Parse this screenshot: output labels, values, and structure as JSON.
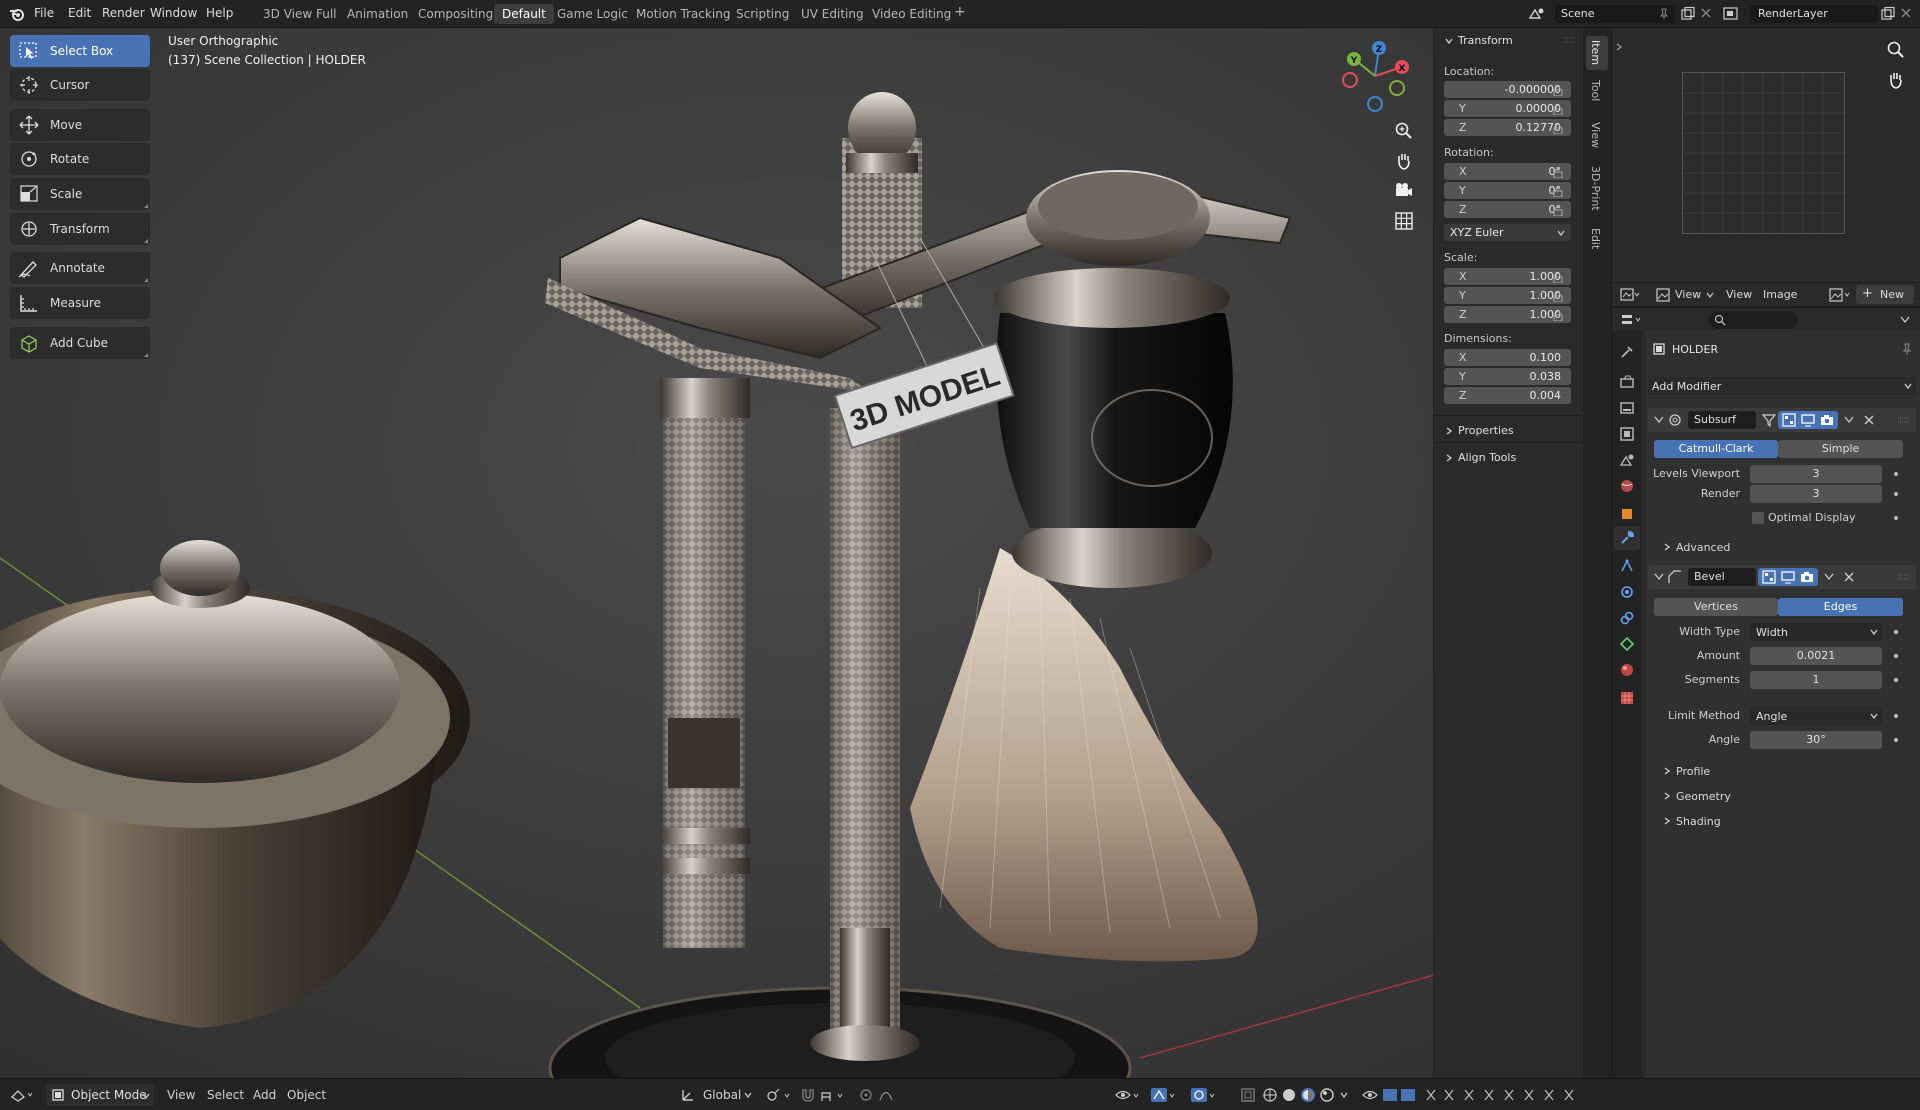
{
  "topbar": {
    "menus": [
      "File",
      "Edit",
      "Render",
      "Window",
      "Help"
    ],
    "workspaces": [
      "3D View Full",
      "Animation",
      "Compositing",
      "Default",
      "Game Logic",
      "Motion Tracking",
      "Scripting",
      "UV Editing",
      "Video Editing"
    ],
    "active_workspace": "Default",
    "add_label": "+",
    "scene": "Scene",
    "render_layer": "RenderLayer"
  },
  "viewport": {
    "view_name": "User Orthographic",
    "collection": "(137) Scene Collection | HOLDER",
    "tag_text": "3D MODEL"
  },
  "tools": [
    {
      "label": "Select Box",
      "icon": "select-box-icon",
      "active": true
    },
    {
      "label": "Cursor",
      "icon": "cursor-icon"
    },
    {
      "label": "Move",
      "icon": "move-icon"
    },
    {
      "label": "Rotate",
      "icon": "rotate-icon"
    },
    {
      "label": "Scale",
      "icon": "scale-icon"
    },
    {
      "label": "Transform",
      "icon": "transform-icon"
    },
    {
      "label": "Annotate",
      "icon": "annotate-icon"
    },
    {
      "label": "Measure",
      "icon": "measure-icon"
    },
    {
      "label": "Add Cube",
      "icon": "add-cube-icon"
    }
  ],
  "gizmo": {
    "x": "X",
    "y": "Y",
    "z": "Z"
  },
  "npanel": {
    "header": "Transform",
    "location_label": "Location:",
    "location": [
      {
        "axis": "X",
        "value": "-0.000000"
      },
      {
        "axis": "Y",
        "value": "0.00000"
      },
      {
        "axis": "Z",
        "value": "0.12770"
      }
    ],
    "rotation_label": "Rotation:",
    "rotation": [
      {
        "axis": "X",
        "value": "0°"
      },
      {
        "axis": "Y",
        "value": "0°"
      },
      {
        "axis": "Z",
        "value": "0°"
      }
    ],
    "rotation_mode": "XYZ Euler",
    "scale_label": "Scale:",
    "scale": [
      {
        "axis": "X",
        "value": "1.000"
      },
      {
        "axis": "Y",
        "value": "1.000"
      },
      {
        "axis": "Z",
        "value": "1.000"
      }
    ],
    "dimensions_label": "Dimensions:",
    "dimensions": [
      {
        "axis": "X",
        "value": "0.100"
      },
      {
        "axis": "Y",
        "value": "0.038"
      },
      {
        "axis": "Z",
        "value": "0.004"
      }
    ],
    "properties_label": "Properties",
    "align_tools_label": "Align Tools",
    "tabs": [
      "Item",
      "Tool",
      "View",
      "3D-Print",
      "Edit"
    ]
  },
  "uv": {
    "view_menu": "View",
    "view2": "View",
    "image": "Image",
    "new": "New"
  },
  "properties": {
    "object_name": "HOLDER",
    "add_modifier": "Add Modifier",
    "subsurf": {
      "name": "Subsurf",
      "mode_a": "Catmull-Clark",
      "mode_b": "Simple",
      "levels_viewport_label": "Levels Viewport",
      "levels_viewport": "3",
      "render_label": "Render",
      "render": "3",
      "optimal_display": "Optimal Display",
      "advanced": "Advanced"
    },
    "bevel": {
      "name": "Bevel",
      "mode_a": "Vertices",
      "mode_b": "Edges",
      "width_type_label": "Width Type",
      "width_type": "Width",
      "amount_label": "Amount",
      "amount": "0.0021",
      "segments_label": "Segments",
      "segments": "1",
      "limit_method_label": "Limit Method",
      "limit_method": "Angle",
      "angle_label": "Angle",
      "angle": "30°",
      "profile": "Profile",
      "geometry": "Geometry",
      "shading": "Shading"
    }
  },
  "bottombar": {
    "mode": "Object Mode",
    "menus": [
      "View",
      "Select",
      "Add",
      "Object"
    ],
    "orientation": "Global"
  },
  "colors": {
    "accent": "#4772b3",
    "x_axis": "#e54b5a",
    "y_axis": "#7bb33b",
    "z_axis": "#3e86d6"
  }
}
